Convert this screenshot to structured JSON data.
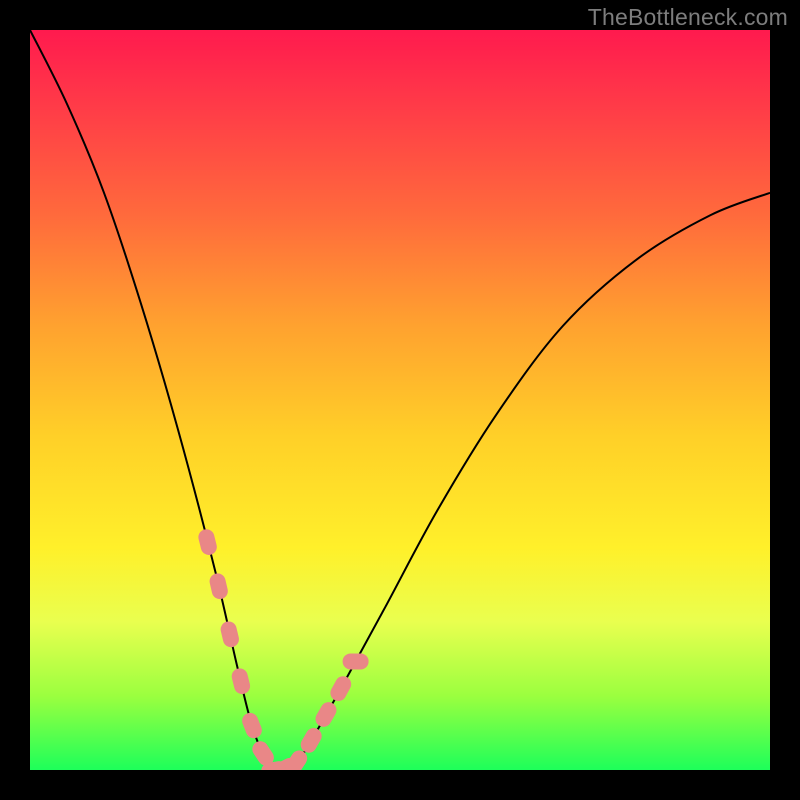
{
  "watermark": "TheBottleneck.com",
  "chart_data": {
    "type": "line",
    "title": "",
    "xlabel": "",
    "ylabel": "",
    "xlim": [
      0,
      100
    ],
    "ylim": [
      0,
      100
    ],
    "curve": {
      "comment": "V-shaped bottleneck curve; minimum (optimal) around x≈33. Values are percentage of vertical span (0=bottom, 100=top).",
      "x": [
        0,
        5,
        10,
        15,
        20,
        25,
        28,
        30,
        32,
        33,
        34,
        36,
        38,
        42,
        48,
        55,
        63,
        72,
        82,
        92,
        100
      ],
      "y": [
        100,
        90,
        78,
        63,
        46,
        27,
        14,
        6,
        1,
        0,
        0,
        1,
        4,
        11,
        22,
        35,
        48,
        60,
        69,
        75,
        78
      ]
    },
    "highlight_segments": {
      "comment": "Pink capsule markers overlaid on the curve near the trough (data-point clusters).",
      "points_x": [
        24,
        25.5,
        27,
        28.5,
        30,
        31.5,
        33,
        34.5,
        36,
        38,
        40,
        42,
        44
      ],
      "color": "#e98787"
    },
    "gradient_stops": [
      {
        "pos": 0.0,
        "color": "#ff1a4e"
      },
      {
        "pos": 0.25,
        "color": "#ff6a3c"
      },
      {
        "pos": 0.55,
        "color": "#ffd028"
      },
      {
        "pos": 0.8,
        "color": "#e9ff4f"
      },
      {
        "pos": 1.0,
        "color": "#1dff5a"
      }
    ]
  }
}
